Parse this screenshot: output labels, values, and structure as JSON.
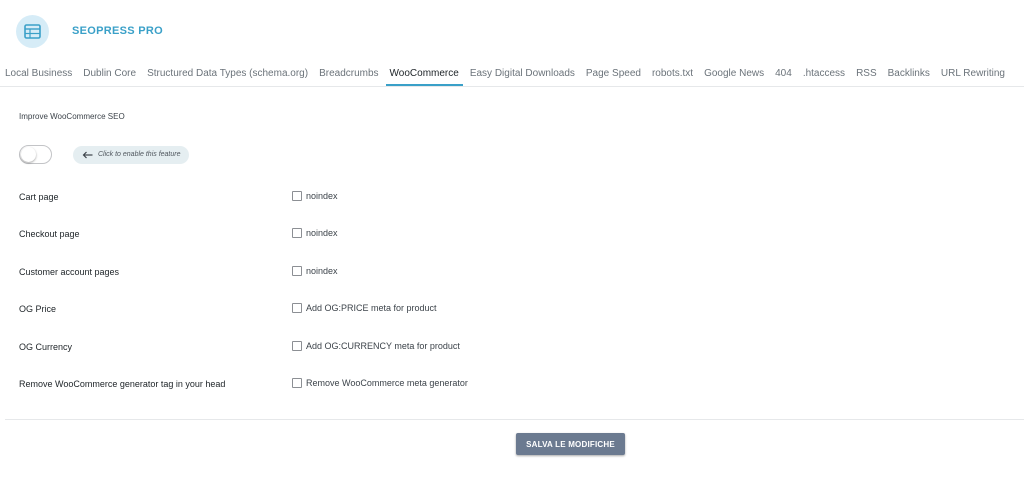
{
  "app": {
    "title": "SEOPRESS PRO",
    "logo_icon": "table-list-icon",
    "accent": "#3aa0c8"
  },
  "tabs": [
    {
      "label": "Local Business",
      "active": false
    },
    {
      "label": "Dublin Core",
      "active": false
    },
    {
      "label": "Structured Data Types (schema.org)",
      "active": false
    },
    {
      "label": "Breadcrumbs",
      "active": false
    },
    {
      "label": "WooCommerce",
      "active": true
    },
    {
      "label": "Easy Digital Downloads",
      "active": false
    },
    {
      "label": "Page Speed",
      "active": false
    },
    {
      "label": "robots.txt",
      "active": false
    },
    {
      "label": "Google News",
      "active": false
    },
    {
      "label": "404",
      "active": false
    },
    {
      "label": ".htaccess",
      "active": false
    },
    {
      "label": "RSS",
      "active": false
    },
    {
      "label": "Backlinks",
      "active": false
    },
    {
      "label": "URL Rewriting",
      "active": false
    }
  ],
  "feature": {
    "title": "Improve WooCommerce SEO",
    "enabled": false,
    "hint": "Click to enable this feature",
    "hint_icon": "arrow-left-icon"
  },
  "settings": [
    {
      "label": "Cart page",
      "option": "noindex",
      "checked": false
    },
    {
      "label": "Checkout page",
      "option": "noindex",
      "checked": false
    },
    {
      "label": "Customer account pages",
      "option": "noindex",
      "checked": false
    },
    {
      "label": "OG Price",
      "option": "Add OG:PRICE meta for product",
      "checked": false
    },
    {
      "label": "OG Currency",
      "option": "Add OG:CURRENCY meta for product",
      "checked": false
    },
    {
      "label": "Remove WooCommerce generator tag in your head",
      "option": "Remove WooCommerce meta generator",
      "checked": false
    }
  ],
  "save_button": {
    "label": "SALVA LE MODIFICHE",
    "color": "#6b7a90"
  }
}
